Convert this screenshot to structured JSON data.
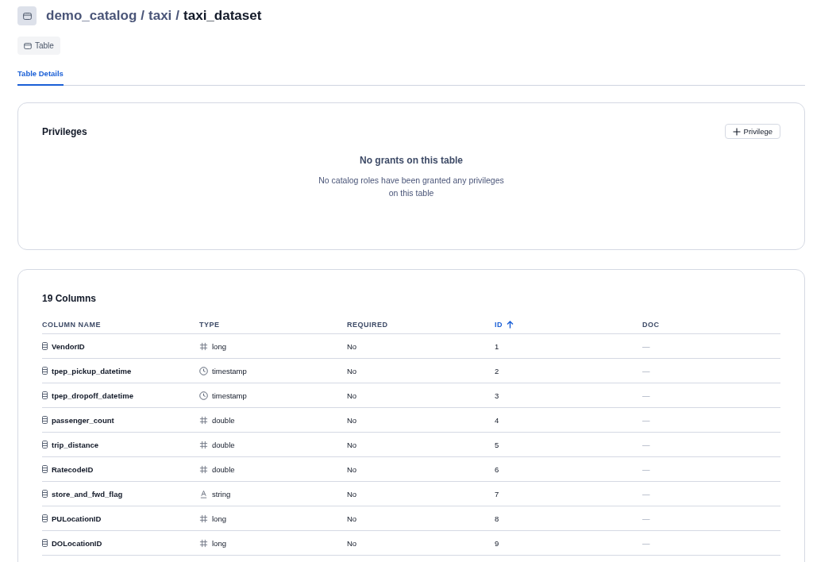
{
  "breadcrumb": {
    "separator": "/",
    "items": [
      {
        "label": "demo_catalog",
        "current": false
      },
      {
        "label": "taxi",
        "current": false
      },
      {
        "label": "taxi_dataset",
        "current": true
      }
    ]
  },
  "badge": {
    "label": "Table"
  },
  "tabs": [
    {
      "label": "Table Details",
      "selected": true
    }
  ],
  "privileges": {
    "title": "Privileges",
    "button": "Privilege",
    "empty_title": "No grants on this table",
    "empty_text": "No catalog roles have been granted any privileges on this table"
  },
  "columns_card": {
    "title": "19 Columns",
    "columns": [
      {
        "label": "COLUMN NAME",
        "sorted": false
      },
      {
        "label": "TYPE",
        "sorted": false
      },
      {
        "label": "REQUIRED",
        "sorted": false
      },
      {
        "label": "ID",
        "sorted": true
      },
      {
        "label": "DOC",
        "sorted": false
      }
    ],
    "rows": [
      {
        "name": "VendorID",
        "kind": "number",
        "type": "long",
        "required": "No",
        "id": "1",
        "doc": "—"
      },
      {
        "name": "tpep_pickup_datetime",
        "kind": "time",
        "type": "timestamp",
        "required": "No",
        "id": "2",
        "doc": "—"
      },
      {
        "name": "tpep_dropoff_datetime",
        "kind": "time",
        "type": "timestamp",
        "required": "No",
        "id": "3",
        "doc": "—"
      },
      {
        "name": "passenger_count",
        "kind": "number",
        "type": "double",
        "required": "No",
        "id": "4",
        "doc": "—"
      },
      {
        "name": "trip_distance",
        "kind": "number",
        "type": "double",
        "required": "No",
        "id": "5",
        "doc": "—"
      },
      {
        "name": "RatecodeID",
        "kind": "number",
        "type": "double",
        "required": "No",
        "id": "6",
        "doc": "—"
      },
      {
        "name": "store_and_fwd_flag",
        "kind": "text",
        "type": "string",
        "required": "No",
        "id": "7",
        "doc": "—"
      },
      {
        "name": "PULocationID",
        "kind": "number",
        "type": "long",
        "required": "No",
        "id": "8",
        "doc": "—"
      },
      {
        "name": "DOLocationID",
        "kind": "number",
        "type": "long",
        "required": "No",
        "id": "9",
        "doc": "—"
      }
    ]
  }
}
